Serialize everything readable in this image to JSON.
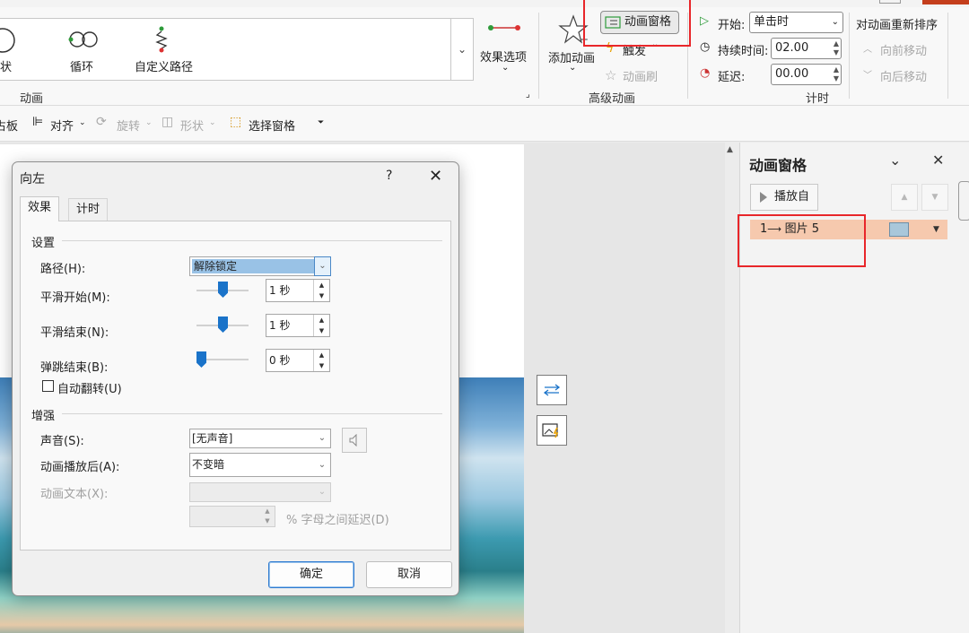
{
  "ribbon": {
    "gallery_items": [
      {
        "label": "状",
        "icon": "shape-circle-icon"
      },
      {
        "label": "循环",
        "icon": "loop-path-icon"
      },
      {
        "label": "自定义路径",
        "icon": "custom-path-icon"
      }
    ],
    "effect_options": "效果选项",
    "group_animation": "动画",
    "add_animation": "添加动画",
    "animation_pane_btn": "动画窗格",
    "trigger": "触发",
    "animation_painter": "动画刷",
    "group_advanced": "高级动画",
    "start_label": "开始:",
    "start_value": "单击时",
    "duration_label": "持续时间:",
    "duration_value": "02.00",
    "delay_label": "延迟:",
    "delay_value": "00.00",
    "group_timing": "计时",
    "reorder_title": "对动画重新排序",
    "move_earlier": "向前移动",
    "move_later": "向后移动"
  },
  "toolbar2": {
    "clipboard_partial": "占板",
    "align": "对齐",
    "rotate": "旋转",
    "shape": "形状",
    "selection_pane": "选择窗格"
  },
  "anim_pane": {
    "title": "动画窗格",
    "play_from": "播放自",
    "items": [
      {
        "order": "1",
        "name": "图片 5"
      }
    ]
  },
  "dialog": {
    "title": "向左",
    "help": "?",
    "tabs": [
      "效果",
      "计时"
    ],
    "settings_section": "设置",
    "path_label": "路径(H):",
    "path_value": "解除锁定",
    "smooth_start_label": "平滑开始(M):",
    "smooth_start_value": "1 秒",
    "smooth_start_level": 0.5,
    "smooth_end_label": "平滑结束(N):",
    "smooth_end_value": "1 秒",
    "smooth_end_level": 0.5,
    "bounce_end_label": "弹跳结束(B):",
    "bounce_end_value": "0 秒",
    "bounce_end_level": 0.0,
    "auto_reverse_label": "自动翻转(U)",
    "auto_reverse_checked": false,
    "enhance_section": "增强",
    "sound_label": "声音(S):",
    "sound_value": "[无声音]",
    "after_anim_label": "动画播放后(A):",
    "after_anim_value": "不变暗",
    "anim_text_label": "动画文本(X):",
    "anim_text_value": "",
    "delay_letters_label": "% 字母之间延迟(D)",
    "ok": "确定",
    "cancel": "取消"
  },
  "colors": {
    "highlight_red": "#e8262a",
    "accent_blue": "#1a73c9",
    "selected_item_bg": "#f6c9ae"
  }
}
